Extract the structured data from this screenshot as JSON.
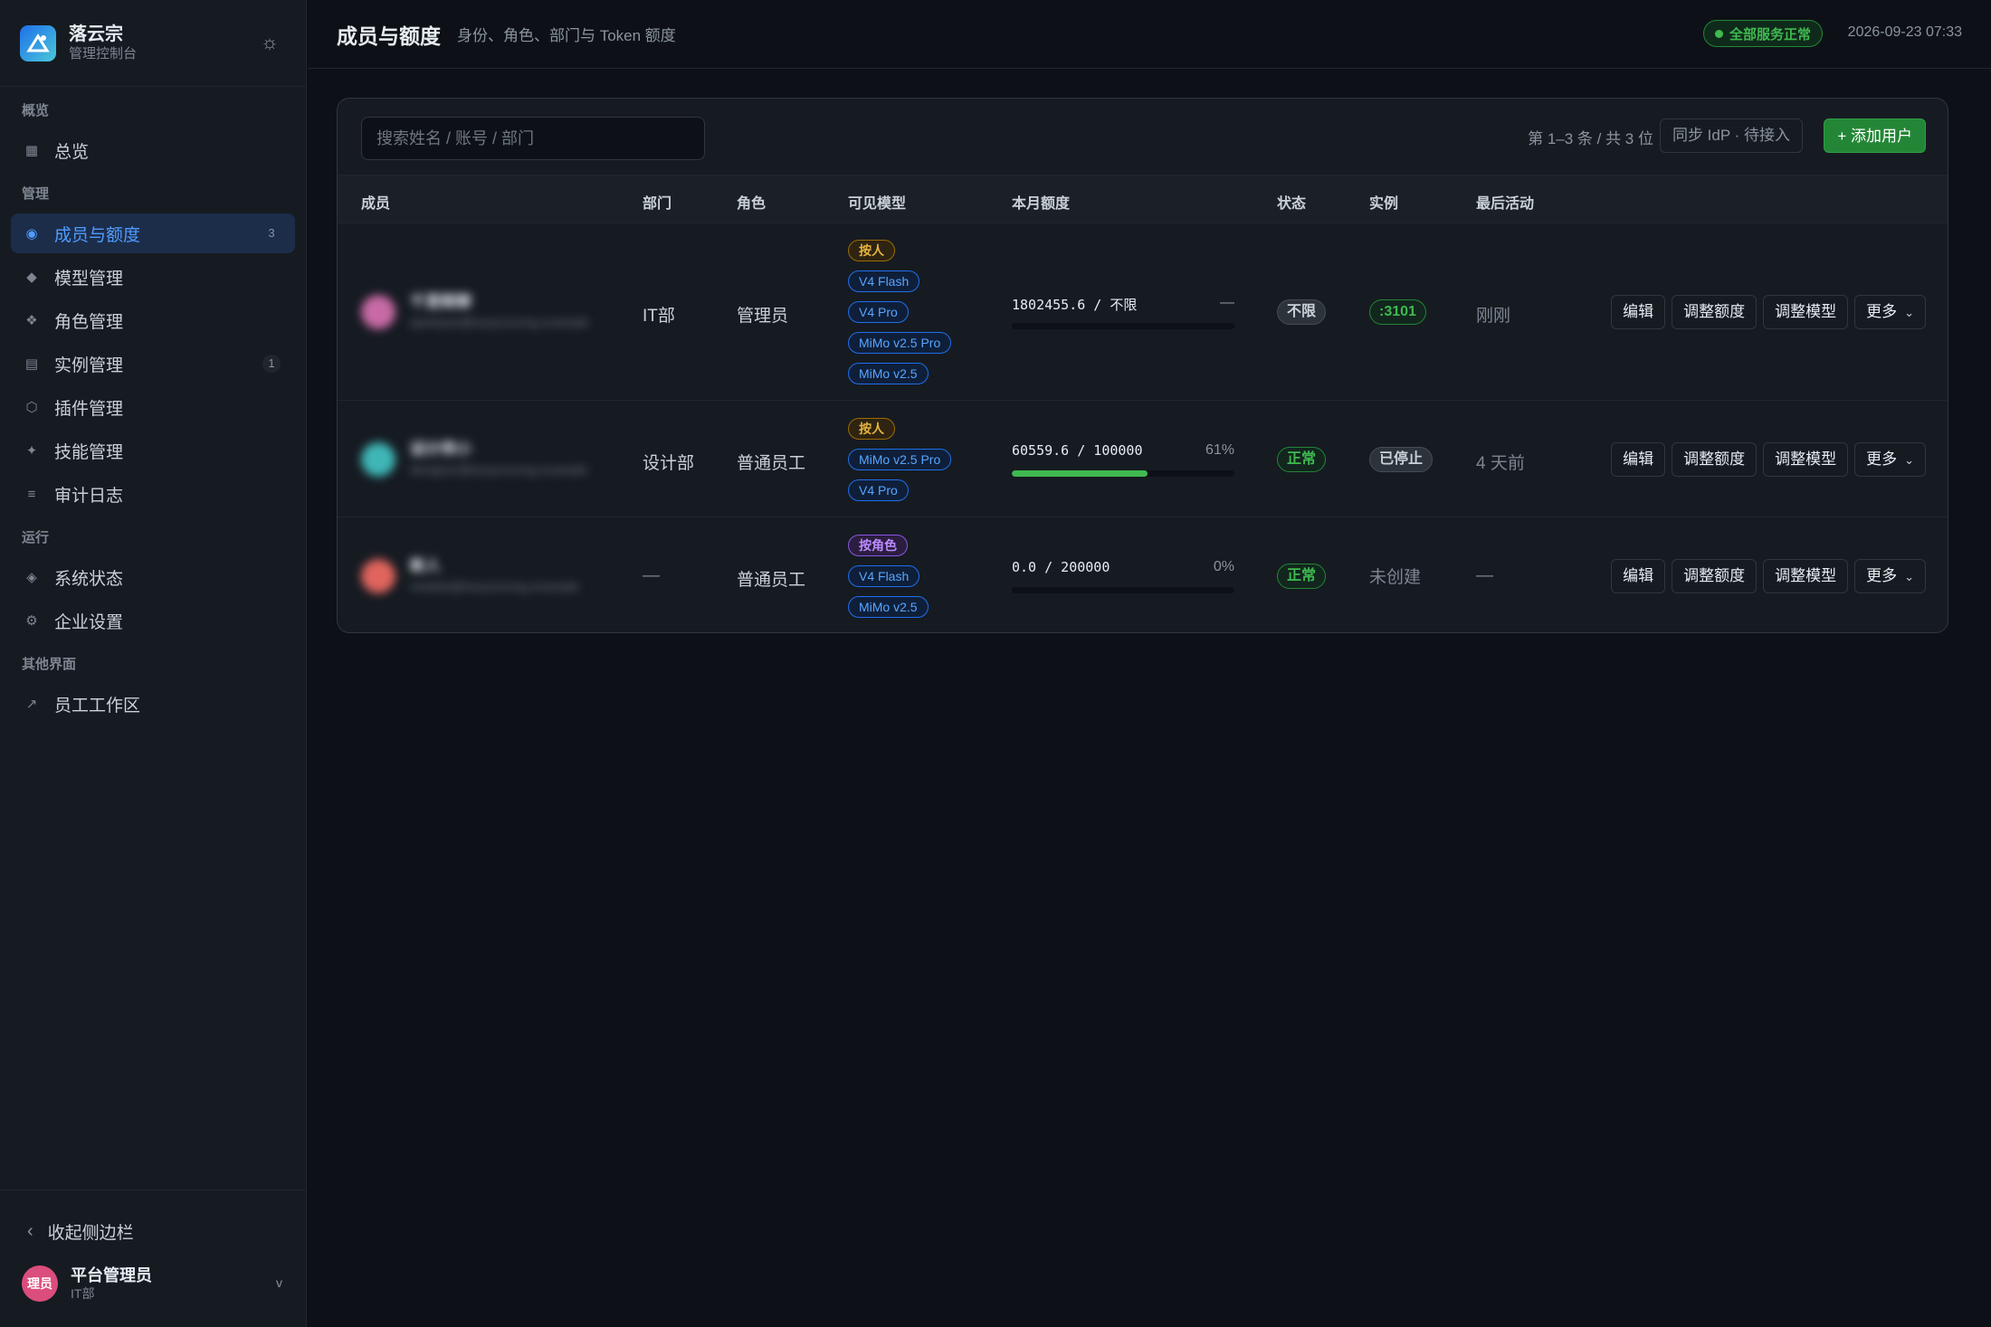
{
  "sidebar": {
    "brand_name": "落云宗",
    "brand_sub": "管理控制台",
    "sections": [
      {
        "title": "概览",
        "items": [
          {
            "label": "总览",
            "icon": "grid-icon",
            "glyph": "▦",
            "badge": ""
          }
        ]
      },
      {
        "title": "管理",
        "items": [
          {
            "label": "成员与额度",
            "icon": "members-icon",
            "glyph": "◉",
            "badge": "3",
            "active": true
          },
          {
            "label": "模型管理",
            "icon": "diamond-icon",
            "glyph": "◆",
            "badge": ""
          },
          {
            "label": "角色管理",
            "icon": "roles-icon",
            "glyph": "❖",
            "badge": ""
          },
          {
            "label": "实例管理",
            "icon": "server-icon",
            "glyph": "▤",
            "badge": "1"
          },
          {
            "label": "插件管理",
            "icon": "plugin-icon",
            "glyph": "⬡",
            "badge": ""
          },
          {
            "label": "技能管理",
            "icon": "sparkle-icon",
            "glyph": "✦",
            "badge": ""
          },
          {
            "label": "审计日志",
            "icon": "list-icon",
            "glyph": "≡",
            "badge": ""
          }
        ]
      },
      {
        "title": "运行",
        "items": [
          {
            "label": "系统状态",
            "icon": "status-icon",
            "glyph": "◈",
            "badge": ""
          },
          {
            "label": "企业设置",
            "icon": "settings-icon",
            "glyph": "⚙",
            "badge": ""
          }
        ]
      },
      {
        "title": "其他界面",
        "items": [
          {
            "label": "员工工作区",
            "icon": "external-link-icon",
            "glyph": "↗",
            "badge": ""
          }
        ]
      }
    ],
    "collapse_label": "收起侧边栏",
    "user": {
      "avatar_text": "理员",
      "name": "平台管理员",
      "dept": "IT部"
    }
  },
  "header": {
    "title": "成员与额度",
    "subtitle": "身份、角色、部门与 Token 额度",
    "status": "全部服务正常",
    "timestamp": "2026-09-23 07:33"
  },
  "toolbar": {
    "search_placeholder": "搜索姓名 / 账号 / 部门",
    "range_text": "第 1–3 条 / 共 3 位",
    "sync_label": "同步 IdP · 待接入",
    "add_label": "+ 添加用户"
  },
  "table": {
    "columns": [
      "成员",
      "部门",
      "角色",
      "可见模型",
      "本月额度",
      "状态",
      "实例",
      "最后活动"
    ],
    "action_labels": {
      "edit": "编辑",
      "quota": "调整额度",
      "model": "调整模型",
      "more": "更多"
    },
    "rows": [
      {
        "avatar_color": "#c86aa6",
        "name": "千里眼聊",
        "sub": "qianliyan@luoyunzong.example",
        "dept": "IT部",
        "role": "管理员",
        "grant": "按人",
        "grant_type": "person",
        "models": [
          "V4 Flash",
          "V4 Pro",
          "MiMo v2.5 Pro",
          "MiMo v2.5"
        ],
        "quota": "1802455.6 / 不限",
        "quota_pct": "—",
        "quota_fraction": 0,
        "status": "不限",
        "status_style": "gray",
        "instance": ":3101",
        "instance_style": "green",
        "last_active": "刚刚"
      },
      {
        "avatar_color": "#3fb6b6",
        "name": "设计师小",
        "sub": "designer@luoyunzong.example",
        "dept": "设计部",
        "role": "普通员工",
        "grant": "按人",
        "grant_type": "person",
        "models": [
          "MiMo v2.5 Pro",
          "V4 Pro"
        ],
        "quota": "60559.6 / 100000",
        "quota_pct": "61%",
        "quota_fraction": 0.61,
        "status": "正常",
        "status_style": "green",
        "instance": "已停止",
        "instance_style": "gray",
        "last_active": "4 天前"
      },
      {
        "avatar_color": "#e0655e",
        "name": "新人",
        "sub": "newbie@luoyunzong.example",
        "dept": "—",
        "role": "普通员工",
        "grant": "按角色",
        "grant_type": "role",
        "models": [
          "V4 Flash",
          "MiMo v2.5"
        ],
        "quota": "0.0 / 200000",
        "quota_pct": "0%",
        "quota_fraction": 0,
        "status": "正常",
        "status_style": "green",
        "instance": "未创建",
        "instance_style": "text",
        "last_active": "—"
      }
    ]
  }
}
